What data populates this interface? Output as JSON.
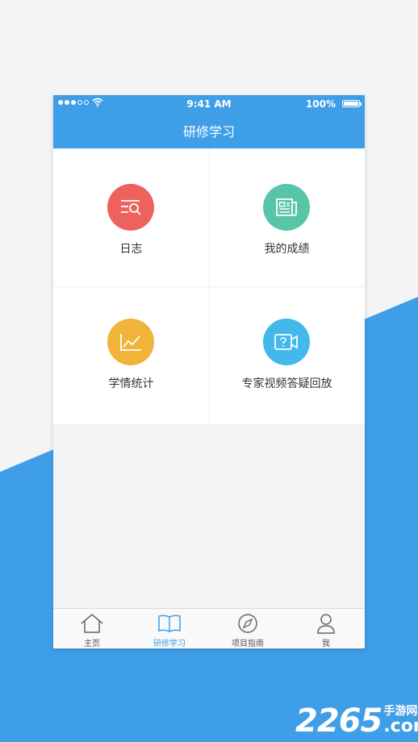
{
  "status_bar": {
    "time": "9:41 AM",
    "battery": "100%"
  },
  "nav": {
    "title": "研修学习"
  },
  "grid": [
    {
      "label": "日志",
      "icon": "log-search-icon",
      "color": "#ee625e"
    },
    {
      "label": "我的成绩",
      "icon": "newspaper-icon",
      "color": "#57c5a7"
    },
    {
      "label": "学情统计",
      "icon": "line-chart-icon",
      "color": "#f2b33a"
    },
    {
      "label": "专家视频答疑回放",
      "icon": "video-question-icon",
      "color": "#43b8ec"
    }
  ],
  "tabs": [
    {
      "label": "主页",
      "icon": "home-icon",
      "active": false
    },
    {
      "label": "研修学习",
      "icon": "book-icon",
      "active": true
    },
    {
      "label": "项目指南",
      "icon": "compass-icon",
      "active": false
    },
    {
      "label": "我",
      "icon": "person-icon",
      "active": false
    }
  ],
  "colors": {
    "primary": "#3f9ee8"
  },
  "watermark": {
    "number": "2265",
    "site_cn": "手游网",
    "site_com": ".com"
  }
}
